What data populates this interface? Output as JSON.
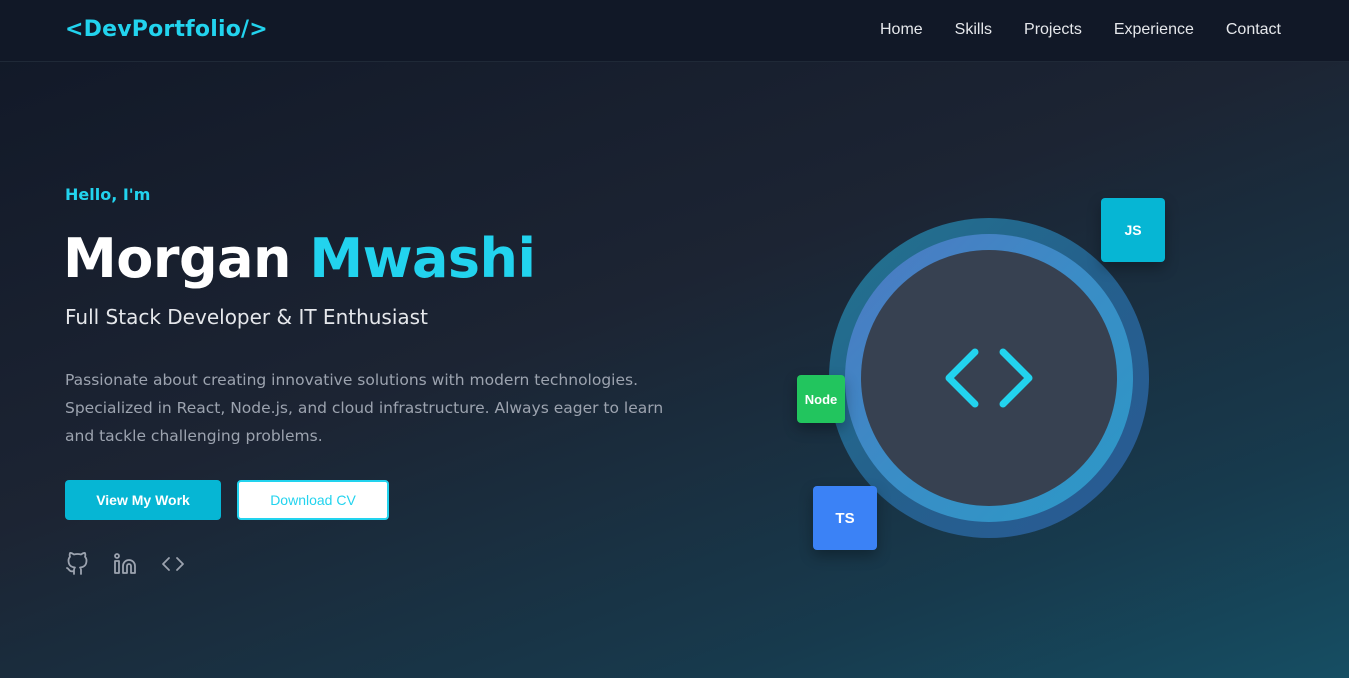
{
  "nav": {
    "logo": "<DevPortfolio/>",
    "links": [
      "Home",
      "Skills",
      "Projects",
      "Experience",
      "Contact"
    ]
  },
  "hero": {
    "greeting": "Hello, I'm",
    "first_name": "Morgan",
    "last_name": "Mwashi",
    "role": "Full Stack Developer & IT Enthusiast",
    "description": "Passionate about creating innovative solutions with modern technologies. Specialized in React, Node.js, and cloud infrastructure. Always eager to learn and tackle challenging problems.",
    "primary_button": "View My Work",
    "secondary_button": "Download CV",
    "socials": [
      "github-icon",
      "linkedin-icon",
      "code-icon"
    ]
  },
  "badges": {
    "js": "JS",
    "node": "Node",
    "ts": "TS"
  },
  "colors": {
    "accent": "#22d3ee",
    "primary_button": "#06b6d4",
    "node_badge": "#22c55e",
    "ts_badge": "#3b82f6",
    "nav_background": "#111827"
  }
}
